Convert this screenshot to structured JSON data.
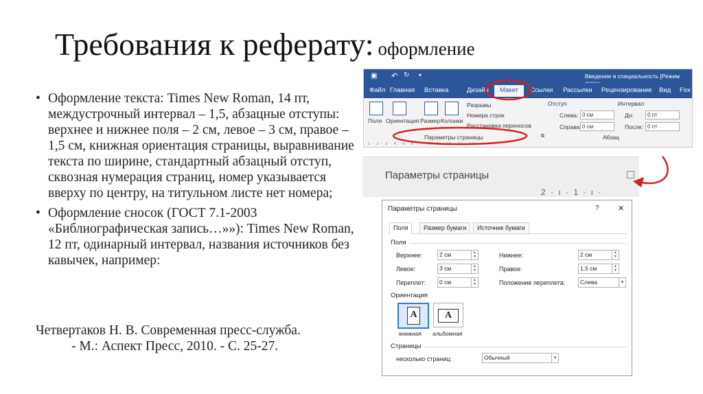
{
  "slide": {
    "title": "Требования к реферату:",
    "title_sub": "оформление",
    "bullets": [
      "Оформление текста: Times New Roman, 14 пт, междустрочный интервал – 1,5, абзацные отступы: верхнее и нижнее поля – 2 см, левое – 3 см, правое – 1,5 см, книжная ориентация страницы, выравнивание текста по ширине, стандартный абзацный отступ, сквозная нумерация страниц, номер указывается вверху по центру, на титульном листе нет номера;",
      "Оформление сносок (ГОСТ 7.1-2003 «Библиографическая запись…»»): Times New Roman, 12 пт, одинарный интервал, названия источников без кавычек, например:"
    ],
    "citation_line1": "Четвертаков Н. В. Современная пресс-служба.",
    "citation_line2": "- М.: Аспект Пресс, 2010. - С. 25-27."
  },
  "ribbon": {
    "doc_title": "Введение в специальность [Режим огран",
    "qat_icons": [
      "save-icon",
      "undo-icon",
      "redo-icon"
    ],
    "tabs": [
      "Файл",
      "Главная",
      "Вставка",
      "Дизайн",
      "Макет",
      "Ссылки",
      "Рассылки",
      "Рецензирование",
      "Вид",
      "Fox"
    ],
    "active_tab": "Макет",
    "buttons": [
      "Поля",
      "Ориентация",
      "Размер",
      "Колонки"
    ],
    "options": [
      "Разрывы",
      "Номера строк",
      "Расстановка переносов"
    ],
    "indent_label": "Отступ",
    "left_label": "Слева:",
    "right_label": "Справа:",
    "indent_left": "0 см",
    "indent_right": "0 см",
    "interval_label": "Интервал",
    "before_label": "До:",
    "after_label": "После:",
    "interval_before": "0 пт",
    "interval_after": "0 пт",
    "group_page": "Параметры страницы",
    "group_paragraph": "Абзац",
    "ruler": "· 1 · 2 · 3 · 4 · 5 · 6 · 7 · 8 · 9 · 10 · 11 · 12"
  },
  "zoom": {
    "caption": "Параметры страницы",
    "ruler": "2 · ı · 1 · ı ·"
  },
  "dialog": {
    "title": "Параметры страницы",
    "help": "?",
    "close": "✕",
    "tabs": [
      "Поля",
      "Размер бумаги",
      "Источник бумаги"
    ],
    "section_fields": "Поля",
    "top_label": "Верхнее:",
    "top_value": "2 см",
    "bottom_label": "Нижнее:",
    "bottom_value": "2 см",
    "left_label": "Левое:",
    "left_value": "3 см",
    "right_label": "Правое:",
    "right_value": "1,5 см",
    "gutter_label": "Переплет:",
    "gutter_value": "0 см",
    "gutter_pos_label": "Положение переплета:",
    "gutter_pos_value": "Слева",
    "section_orient": "Ориентация",
    "portrait": "книжная",
    "landscape": "альбомная",
    "section_pages": "Страницы",
    "multiple_label": "несколько страниц:",
    "multiple_value": "Обычный"
  },
  "colors": {
    "ribbon_blue": "#2b579a",
    "highlight_red": "#d32020"
  }
}
